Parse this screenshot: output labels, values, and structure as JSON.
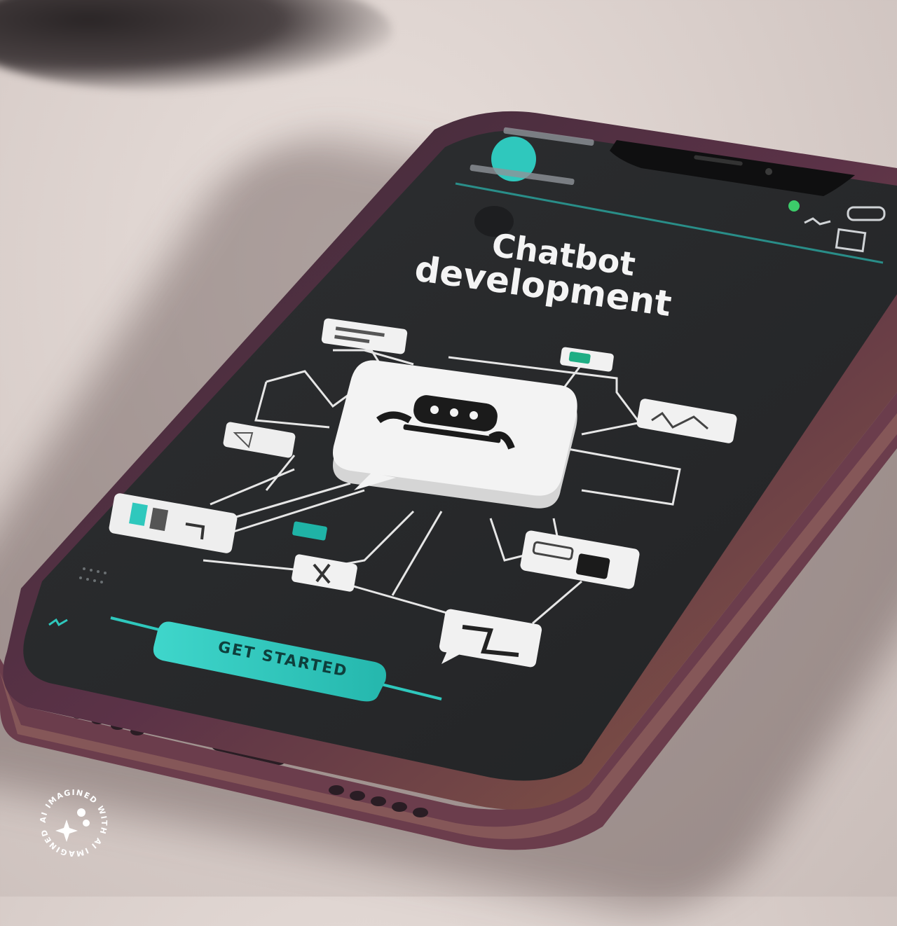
{
  "screen": {
    "title_line1": "Chatbot",
    "title_line2": "development",
    "cta_button_label": "GET STARTED"
  },
  "watermark": {
    "text": "AI IMAGINED WITH AI IMAGINED WITH"
  },
  "colors": {
    "screen_bg": "#2b2c2e",
    "accent_teal": "#2fc8bd",
    "diagram_lines": "#e6e6e6",
    "card_white": "#f1f1f1",
    "phone_frame": "#4a2a3a"
  },
  "icons": {
    "center": "chatbot-robot-icon",
    "status_dot": "teal-dot-icon"
  }
}
